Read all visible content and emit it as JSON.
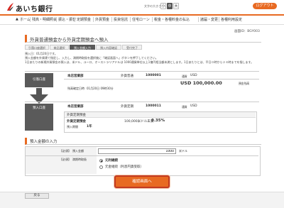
{
  "header": {
    "logo_text": "あいち銀行",
    "font_size_label": "文字の大きさ",
    "font_sizes": [
      "小",
      "中",
      "大"
    ],
    "logout_label": "ログアウト"
  },
  "nav": {
    "items": [
      "ホーム",
      "残高・明細照会",
      "振込・振替",
      "定期預金",
      "外貨預金",
      "投資信託",
      "住宅ローン",
      "税金・各種料金の払込",
      "諸届・変更",
      "各種利用設定"
    ]
  },
  "screen_id": "画面ID：BGY003",
  "page_title": "外貨普通預金から外貨定期預金へ預入",
  "steps": [
    "引落口座選択",
    "商品選択",
    "預入金額入力",
    "預入内容確認",
    "受付完了"
  ],
  "active_step": 2,
  "notes": [
    "預入日：01月20日です。",
    "預入金額を外貨建て指定し、入力し、満期時取扱を選択後に「確認画面へ」ボタンを押下してください。",
    "1日あたりの新規外貨預金の預入は、米ドル、ユーロ、オーストラリアドルは 1000通貨単位以上1億円相当額未満とします。1日あたりとは、平日０時から２４時までを指します。"
  ],
  "debit_account": {
    "label": "引落口座",
    "branch": "本店営業部",
    "type": "外貨普通",
    "number": "1000001",
    "currency_label": "通貨",
    "currency": "USD",
    "balance": "USD 100,000.00",
    "balance_label": "預金残高",
    "updated_label": "残高確定日時",
    "updated": "01月20日 09時30分"
  },
  "deposit_account": {
    "label": "預入口座",
    "branch": "本店営業部",
    "type": "外貨定期",
    "number": "1000011",
    "currency_label": "通貨",
    "currency": "USD"
  },
  "product": {
    "header": "外貨定期預金",
    "name": "外貨定期預金",
    "condition": "100,000米ドル未満",
    "rate": "0.35%",
    "term_label": "預入期間",
    "term": "1年"
  },
  "amount_section": {
    "title": "預入金額の入力",
    "required": "【必須】",
    "amount_label": "預入金額",
    "amount_value": "1000",
    "amount_unit": "米ドル",
    "maturity_label": "満期時取扱",
    "option_1": "元利継続",
    "option_2": "元金継続（利息円貨受取）"
  },
  "confirm_button": "確認画面へ",
  "back_button": "戻る"
}
